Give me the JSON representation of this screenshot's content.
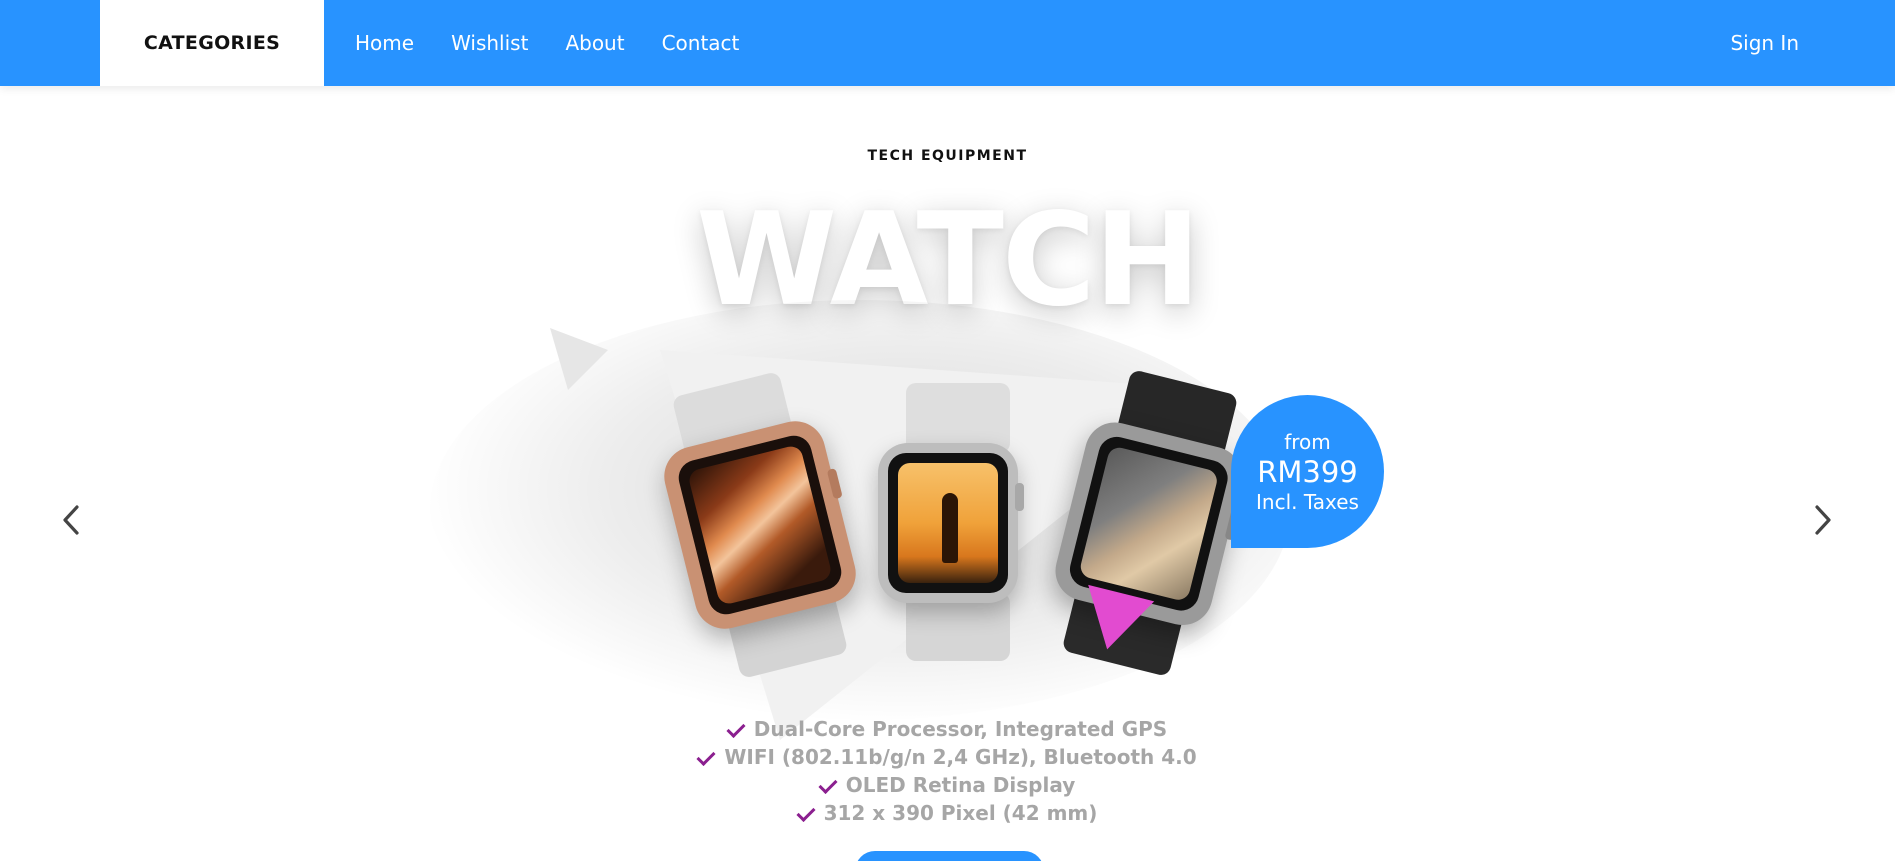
{
  "navbar": {
    "categories_label": "CATEGORIES",
    "links": [
      "Home",
      "Wishlist",
      "About",
      "Contact"
    ],
    "signin_label": "Sign In",
    "accent_color": "#2893ff"
  },
  "hero": {
    "eyebrow": "TECH EQUIPMENT",
    "title": "WATCH",
    "price": {
      "from": "from",
      "amount": "RM399",
      "note": "Incl. Taxes"
    },
    "features": [
      "Dual-Core Processor, Integrated GPS",
      "WIFI (802.11b/g/n 2,4 GHz), Bluetooth 4.0",
      "OLED Retina Display",
      "312 x 390 Pixel (42 mm)"
    ],
    "check_color": "#8b1f8f",
    "triangle_accent": "#e24bd0"
  },
  "carousel": {
    "prev_icon": "chevron-left-icon",
    "next_icon": "chevron-right-icon"
  }
}
